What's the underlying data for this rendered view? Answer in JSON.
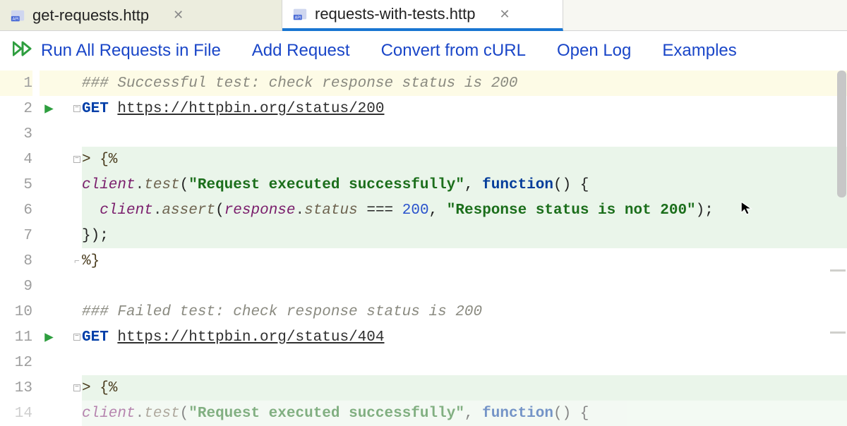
{
  "tabs": [
    {
      "label": "get-requests.http",
      "active": false
    },
    {
      "label": "requests-with-tests.http",
      "active": true
    }
  ],
  "toolbar": {
    "run_all": "Run All Requests in File",
    "add_request": "Add Request",
    "convert_curl": "Convert from cURL",
    "open_log": "Open Log",
    "examples": "Examples"
  },
  "code": {
    "l1_comment": "### Successful test: check response status is 200",
    "l2_method": "GET",
    "l2_url": "https://httpbin.org/status/200",
    "l4_open": "> {%",
    "l5_a": "client",
    "l5_b": ".",
    "l5_c": "test",
    "l5_d": "(",
    "l5_str": "\"Request executed successfully\"",
    "l5_e": ", ",
    "l5_kw": "function",
    "l5_f": "() {",
    "l6_pad": "  ",
    "l6_a": "client",
    "l6_b": ".",
    "l6_c": "assert",
    "l6_d": "(",
    "l6_e": "response",
    "l6_f": ".",
    "l6_g": "status",
    "l6_h": " === ",
    "l6_num": "200",
    "l6_i": ", ",
    "l6_str": "\"Response status is not 200\"",
    "l6_j": ");",
    "l7": "});",
    "l8_close": "%}",
    "l10_comment": "### Failed test: check response status is 200",
    "l11_method": "GET",
    "l11_url": "https://httpbin.org/status/404",
    "l13_open": "> {%",
    "l14_a": "client",
    "l14_b": ".",
    "l14_c": "test",
    "l14_d": "(",
    "l14_str": "\"Request executed successfully\"",
    "l14_e": ", ",
    "l14_kw": "function",
    "l14_f": "() {"
  },
  "icons": {
    "file_badge": "API",
    "run": "run",
    "fold_minus": "−",
    "fold_end": "┘"
  }
}
